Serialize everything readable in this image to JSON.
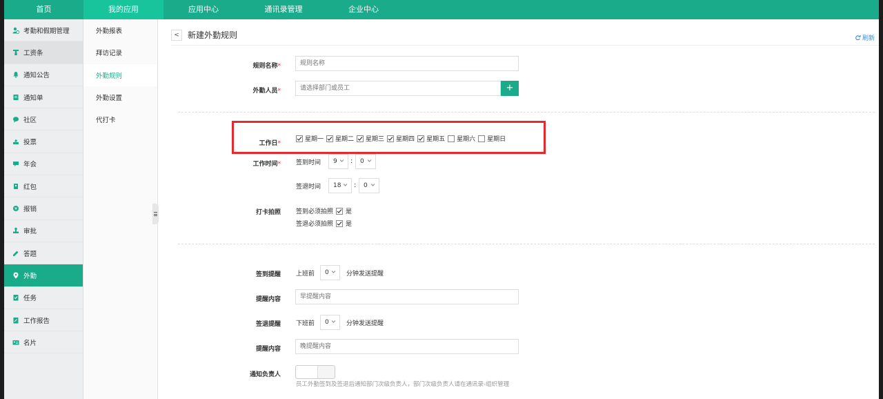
{
  "topnav": {
    "items": [
      {
        "label": "首页"
      },
      {
        "label": "我的应用"
      },
      {
        "label": "应用中心"
      },
      {
        "label": "通讯录管理"
      },
      {
        "label": "企业中心"
      }
    ],
    "active_index": 1
  },
  "sidebar": {
    "items": [
      {
        "label": "考勤和假期管理",
        "icon": "user-clock-icon"
      },
      {
        "label": "工资条",
        "icon": "tie-icon"
      },
      {
        "label": "通知公告",
        "icon": "bell-icon"
      },
      {
        "label": "通知单",
        "icon": "document-icon"
      },
      {
        "label": "社区",
        "icon": "chat-icon"
      },
      {
        "label": "投票",
        "icon": "vote-icon"
      },
      {
        "label": "年会",
        "icon": "flag-icon"
      },
      {
        "label": "红包",
        "icon": "red-packet-icon"
      },
      {
        "label": "报销",
        "icon": "coin-icon"
      },
      {
        "label": "审批",
        "icon": "stamp-icon"
      },
      {
        "label": "答题",
        "icon": "pencil-icon"
      },
      {
        "label": "外勤",
        "icon": "location-pin-icon"
      },
      {
        "label": "任务",
        "icon": "checklist-icon"
      },
      {
        "label": "工作报告",
        "icon": "report-icon"
      },
      {
        "label": "名片",
        "icon": "card-icon"
      }
    ],
    "active_index": 11
  },
  "subnav": {
    "items": [
      {
        "label": "外勤报表"
      },
      {
        "label": "拜访记录"
      },
      {
        "label": "外勤规则"
      },
      {
        "label": "外勤设置"
      },
      {
        "label": "代打卡"
      }
    ],
    "active_index": 2
  },
  "page": {
    "back_glyph": "<",
    "title": "新建外勤规则",
    "refresh_label": "刷新"
  },
  "form": {
    "rule_name": {
      "label": "规则名称",
      "required_mark": "*",
      "placeholder": "规则名称"
    },
    "field_staff": {
      "label": "外勤人员",
      "required_mark": "*",
      "placeholder": "请选择部门或员工",
      "add_glyph": "+"
    },
    "workdays": {
      "label": "工作日",
      "required_mark": "*",
      "days": [
        {
          "label": "星期一",
          "checked": true
        },
        {
          "label": "星期二",
          "checked": true
        },
        {
          "label": "星期三",
          "checked": true
        },
        {
          "label": "星期四",
          "checked": true
        },
        {
          "label": "星期五",
          "checked": true
        },
        {
          "label": "星期六",
          "checked": false
        },
        {
          "label": "星期日",
          "checked": false
        }
      ]
    },
    "work_time": {
      "label": "工作时间",
      "required_mark": "*",
      "sign_in_label": "签到时间",
      "sign_in_hour": "9",
      "sign_in_minute": "0",
      "sign_out_label": "签退时间",
      "sign_out_hour": "18",
      "sign_out_minute": "0",
      "separator": ":"
    },
    "photo": {
      "label": "打卡拍照",
      "sign_in_label": "签到必须拍照",
      "sign_in_checked": true,
      "sign_in_value": "是",
      "sign_out_label": "签退必须拍照",
      "sign_out_checked": true,
      "sign_out_value": "是"
    },
    "sign_in_reminder": {
      "label": "签到提醒",
      "prefix": "上班前",
      "value": "0",
      "suffix": "分钟发送提醒"
    },
    "reminder_content_1": {
      "label": "提醒内容",
      "placeholder": "早提醒内容"
    },
    "sign_out_reminder": {
      "label": "签退提醒",
      "prefix": "下班前",
      "value": "0",
      "suffix": "分钟发送提醒"
    },
    "reminder_content_2": {
      "label": "提醒内容",
      "placeholder": "晚提醒内容"
    },
    "notify_manager": {
      "label": "通知负责人",
      "enabled": false,
      "hint": "员工外勤签到及签退后通知部门次级负责人，部门次级负责人请在通讯录-组织管理"
    }
  },
  "colors": {
    "brand": "#1aab8a",
    "highlight_box": "#e8282b",
    "required": "#e33333"
  }
}
